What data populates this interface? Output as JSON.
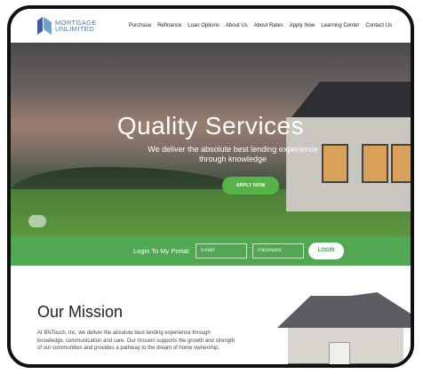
{
  "brand": {
    "name_line1": "MORTGAGE",
    "name_line2": "UNLIMITED",
    "logo_colors": [
      "#3a5fa8",
      "#6fa0d8"
    ]
  },
  "nav": {
    "items": [
      "Purchase",
      "Refinance",
      "Loan Options",
      "About Us",
      "About Rates",
      "Apply Now",
      "Learning Center",
      "Contact Us"
    ]
  },
  "hero": {
    "title": "Quality Services",
    "subtitle": "We deliver the absolute best lending experience through knowledge",
    "cta_label": "APPLY NOW"
  },
  "portal": {
    "label": "Login To My Portal:",
    "email_placeholder": "Email",
    "password_placeholder": "Password",
    "login_label": "LOGIN"
  },
  "mission": {
    "title": "Our Mission",
    "text": "At BNTouch, Inc. we deliver the absolute best lending experience through knowledge, communication and care. Our mission supports the growth and strength of our communities and provides a pathway to the dream of home ownership."
  },
  "colors": {
    "accent_green": "#57b347",
    "portal_green": "#43a044",
    "logo_blue": "#4a7ab8"
  }
}
